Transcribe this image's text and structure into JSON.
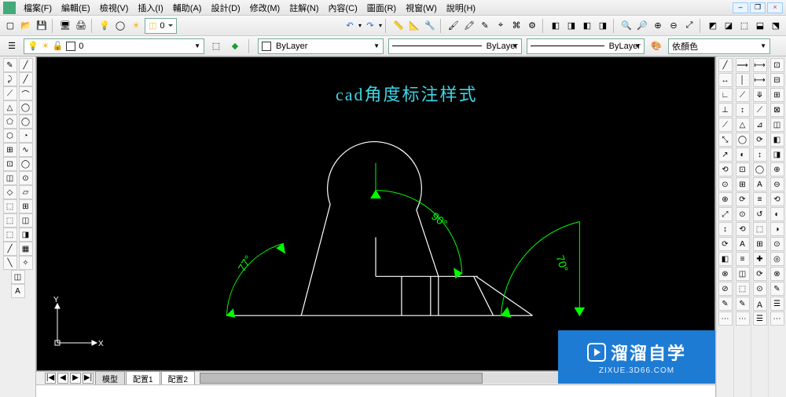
{
  "menu": {
    "items": [
      "檔案(F)",
      "編輯(E)",
      "檢視(V)",
      "插入(I)",
      "輔助(A)",
      "設計(D)",
      "修改(M)",
      "註解(N)",
      "內容(C)",
      "圖面(R)",
      "視窗(W)",
      "說明(H)"
    ]
  },
  "window_buttons": {
    "minimize": "–",
    "restore": "❐",
    "close": "×"
  },
  "toolbar_icons": {
    "new": "▢",
    "open": "📂",
    "save": "💾",
    "monitor": "🖥",
    "print": "🖨",
    "bulb": "💡",
    "circles": "◯",
    "sun": "☀",
    "layer": "◫",
    "undo": "↶",
    "redo": "↷",
    "meas1": "📏",
    "meas2": "📐",
    "meas3": "🔧",
    "meas4": "🖌",
    "meas5": "🖍",
    "meas6": "✎",
    "meas7": "⌖",
    "meas8": "⌘",
    "meas9": "⚙",
    "meas10": "◧",
    "meas11": "◨",
    "zoom1": "🔍",
    "zoom2": "🔎",
    "zoomin": "⊕",
    "zoomout": "⊖",
    "zoomext": "⤢",
    "cube1": "◩",
    "cube2": "◪",
    "cube3": "⬚",
    "cube4": "⬓",
    "cube5": "⬔"
  },
  "layers": {
    "current": "0",
    "icons": {
      "bulb": "💡",
      "sun": "☀",
      "freeze": "❄",
      "lock": "🔓",
      "color": "◻"
    }
  },
  "props": {
    "bylayer_label": "ByLayer",
    "color_label": "依顏色"
  },
  "canvas": {
    "title": "cad角度标注样式",
    "angles": {
      "a1": "77°",
      "a2": "90°",
      "a3": "70°"
    },
    "axes": {
      "x": "X",
      "y": "Y"
    }
  },
  "tabs": {
    "nav": [
      "|◀",
      "◀",
      "▶",
      "▶|"
    ],
    "items": [
      "模型",
      "配置1",
      "配置2"
    ],
    "active": 0
  },
  "watermark": {
    "brand": "溜溜自学",
    "url": "ZIXUE.3D66.COM"
  },
  "left_tools": [
    [
      "✎",
      "╱"
    ],
    [
      "⤸",
      "╱"
    ],
    [
      "⟋",
      "⌒"
    ],
    [
      "△",
      "◯"
    ],
    [
      "⬠",
      "◯"
    ],
    [
      "⬡",
      "◔"
    ],
    [
      "⊞",
      "∿"
    ],
    [
      "⊡",
      "◯"
    ],
    [
      "◫",
      "⊙"
    ],
    [
      "◇",
      "▱"
    ],
    [
      "⬚",
      "⊞"
    ],
    [
      "⬚",
      "◫"
    ],
    [
      "⬚",
      "◨"
    ],
    [
      "╱",
      "▦"
    ],
    [
      "╲",
      "✧"
    ],
    [
      "◫",
      ""
    ],
    [
      "A",
      ""
    ]
  ],
  "right_tools": {
    "col1": [
      "╱",
      "↔",
      "∟",
      "⊥",
      "⟋",
      "⤡",
      "↗",
      "⟲",
      "⊙",
      "⊕",
      "⤢",
      "↕",
      "⟳",
      "◧",
      "⊗",
      "⊘",
      "✎",
      "⋯"
    ],
    "col2": [
      "⟶",
      "│",
      "⟋",
      "↕",
      "△",
      "◯",
      "◐",
      "⊡",
      "⊞",
      "⟳",
      "⊙",
      "⟲",
      "A",
      "≡",
      "◫",
      "⬚",
      "✎",
      "⋯"
    ],
    "col3": [
      "⟼",
      "⟼",
      "⤋",
      "⟋",
      "⊿",
      "⟳",
      "↕",
      "◯",
      "A",
      "≡",
      "↺",
      "⬚",
      "⊞",
      "✚",
      "⟳",
      "⊙",
      "Ａ",
      "☰"
    ],
    "col4": [
      "⊡",
      "⊟",
      "⊞",
      "⊠",
      "◫",
      "◧",
      "◨",
      "⊕",
      "⊖",
      "⟲",
      "◐",
      "◑",
      "⊙",
      "◎",
      "⊗",
      "✎",
      "☰",
      "⋯"
    ]
  }
}
